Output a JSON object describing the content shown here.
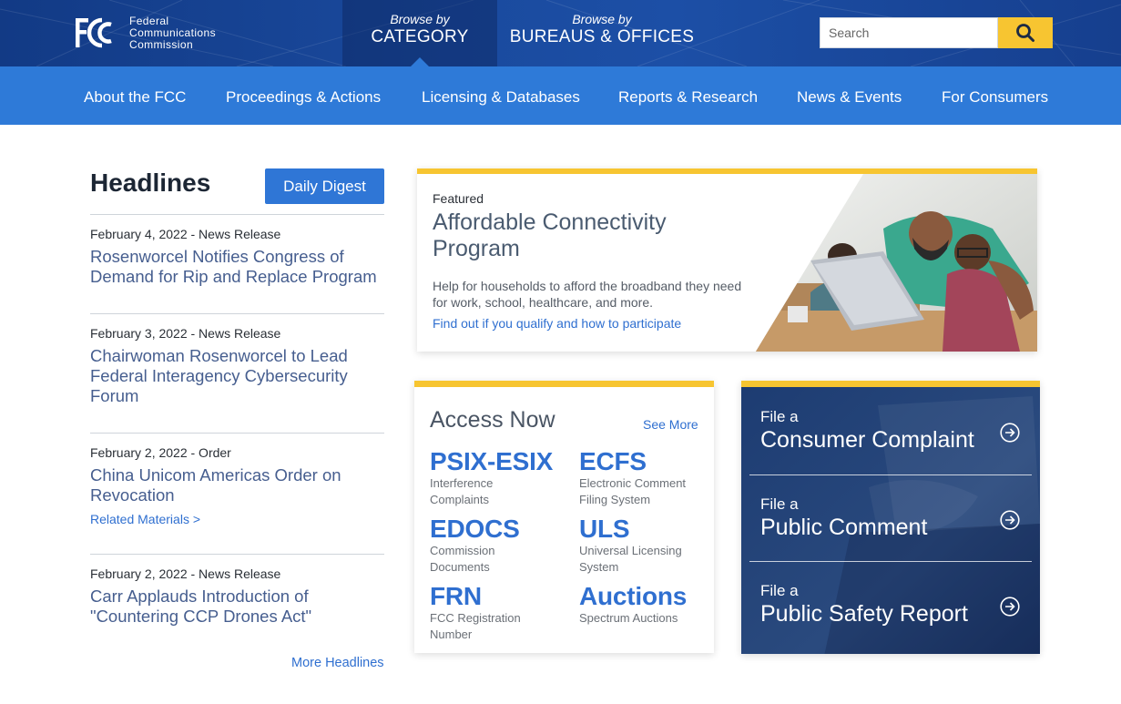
{
  "header": {
    "logo_lines": [
      "Federal",
      "Communications",
      "Commission"
    ],
    "browse_category": {
      "prefix": "Browse by",
      "label": "CATEGORY"
    },
    "browse_bureaus": {
      "prefix": "Browse by",
      "label": "BUREAUS & OFFICES"
    },
    "search": {
      "placeholder": "Search"
    }
  },
  "nav": {
    "items": [
      {
        "label": "About the FCC"
      },
      {
        "label": "Proceedings & Actions"
      },
      {
        "label": "Licensing & Databases"
      },
      {
        "label": "Reports & Research"
      },
      {
        "label": "News & Events"
      },
      {
        "label": "For Consumers"
      }
    ]
  },
  "headlines": {
    "title": "Headlines",
    "digest_label": "Daily Digest",
    "items": [
      {
        "meta": "February 4, 2022 - News Release",
        "title": "Rosenworcel Notifies Congress of Demand for Rip and Replace Program"
      },
      {
        "meta": "February 3, 2022 - News Release",
        "title": "Chairwoman Rosenworcel to Lead Federal Interagency Cybersecurity Forum"
      },
      {
        "meta": "February 2, 2022 - Order",
        "title": "China Unicom Americas Order on Revocation",
        "related": "Related Materials >"
      },
      {
        "meta": "February 2, 2022 - News Release",
        "title": "Carr Applauds Introduction of \"Countering CCP Drones Act\""
      }
    ],
    "more_label": "More Headlines"
  },
  "featured": {
    "kicker": "Featured",
    "title": "Affordable Connectivity Program",
    "description": "Help for households to afford the broadband they need for work, school, healthcare, and more.",
    "link": "Find out if you qualify and how to participate"
  },
  "access": {
    "title": "Access Now",
    "see_more": "See More",
    "tools": [
      {
        "name": "PSIX-ESIX",
        "desc": "Interference Complaints"
      },
      {
        "name": "ECFS",
        "desc": "Electronic Comment Filing System"
      },
      {
        "name": "EDOCS",
        "desc": "Commission Documents"
      },
      {
        "name": "ULS",
        "desc": "Universal Licensing System"
      },
      {
        "name": "FRN",
        "desc": "FCC Registration Number"
      },
      {
        "name": "Auctions",
        "desc": "Spectrum Auctions"
      }
    ]
  },
  "file": {
    "items": [
      {
        "small": "File a",
        "big": "Consumer Complaint"
      },
      {
        "small": "File a",
        "big": "Public Comment"
      },
      {
        "small": "File a",
        "big": "Public Safety Report"
      }
    ]
  },
  "colors": {
    "header_dark": "#1a4a9e",
    "nav_blue": "#2e7ad8",
    "accent_yellow": "#f7c531",
    "link_blue": "#2f6fd0",
    "headline_link": "#465e8f",
    "file_panel": "#1b3a6e"
  },
  "icons": {
    "search_button": "magnifier-icon",
    "file_arrow": "circle-arrow-right-icon"
  }
}
